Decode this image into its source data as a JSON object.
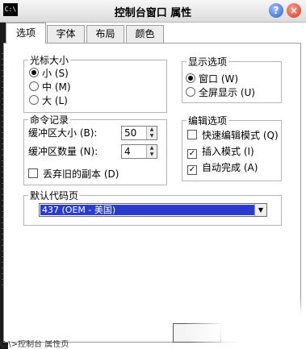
{
  "window": {
    "icon_label": "C:\\",
    "title": "控制台窗口 属性",
    "help_button": "?",
    "close_button": "×"
  },
  "tabs": [
    {
      "label": "选项",
      "active": true
    },
    {
      "label": "字体",
      "active": false
    },
    {
      "label": "布局",
      "active": false
    },
    {
      "label": "颜色",
      "active": false
    }
  ],
  "cursor_size": {
    "title": "光标大小",
    "options": [
      {
        "label": "小 (S)",
        "selected": true
      },
      {
        "label": "中 (M)",
        "selected": false
      },
      {
        "label": "大 (L)",
        "selected": false
      }
    ]
  },
  "display_options": {
    "title": "显示选项",
    "options": [
      {
        "label": "窗口 (W)",
        "selected": true
      },
      {
        "label": "全屏显示 (U)",
        "selected": false
      }
    ]
  },
  "command_history": {
    "title": "命令记录",
    "buffer_size_label": "缓冲区大小 (B):",
    "buffer_size_value": "50",
    "buffer_count_label": "缓冲区数量 (N):",
    "buffer_count_value": "4",
    "discard_label": "丢弃旧的副本 (D)",
    "discard_checked": false
  },
  "edit_options": {
    "title": "编辑选项",
    "quick_edit_label": "快速编辑模式 (Q)",
    "quick_edit_checked": false,
    "insert_mode_label": "插入模式 (I)",
    "insert_mode_checked": true,
    "autocomplete_label": "自动完成 (A)",
    "autocomplete_checked": true
  },
  "codepage": {
    "title": "默认代码页",
    "value": "437   (OEM - 美国)"
  },
  "footer": {
    "text": "C:\\>控制台 属性页"
  },
  "colors": {
    "selection": "#2a3bd0",
    "close_button": "#d13b20",
    "help_button": "#2b5fd0"
  }
}
